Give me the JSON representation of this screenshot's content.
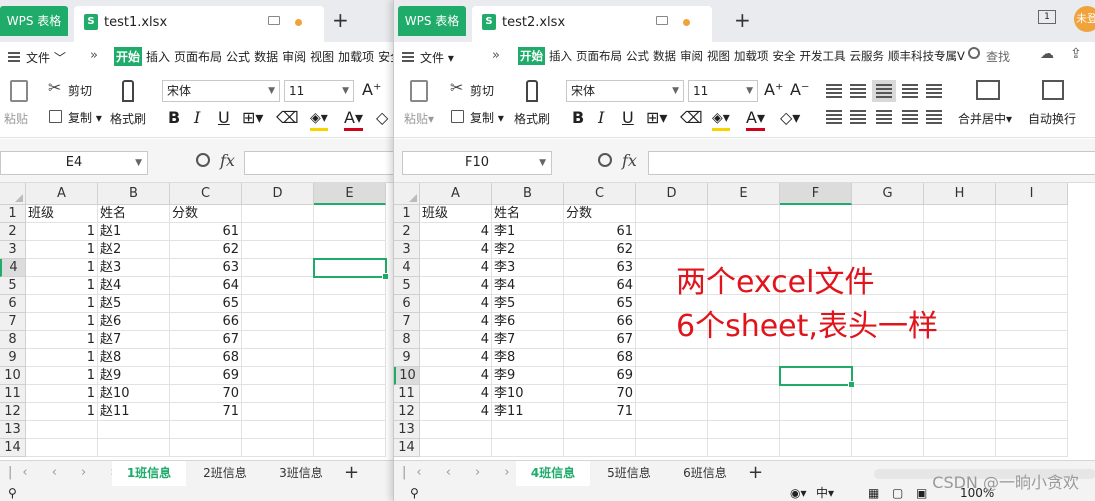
{
  "win1": {
    "app_tab": "WPS 表格",
    "doc_tab": "test1.xlsx",
    "menu_file": "文件",
    "menu_more": "»",
    "menu_tabs": [
      "开始",
      "插入",
      "页面布局",
      "公式",
      "数据",
      "审阅",
      "视图",
      "加载项",
      "安全"
    ],
    "ribbon": {
      "paste": "粘贴",
      "cut": "剪切",
      "copy": "复制",
      "format_painter": "格式刷",
      "font": "宋体",
      "size": "11"
    },
    "name_box": "E4",
    "columns": [
      "A",
      "B",
      "C",
      "D",
      "E"
    ],
    "rows": [
      "1",
      "2",
      "3",
      "4",
      "5",
      "6",
      "7",
      "8",
      "9",
      "10",
      "11",
      "12",
      "13",
      "14"
    ],
    "data": [
      [
        "班级",
        "姓名",
        "分数"
      ],
      [
        "1",
        "赵1",
        "61"
      ],
      [
        "1",
        "赵2",
        "62"
      ],
      [
        "1",
        "赵3",
        "63"
      ],
      [
        "1",
        "赵4",
        "64"
      ],
      [
        "1",
        "赵5",
        "65"
      ],
      [
        "1",
        "赵6",
        "66"
      ],
      [
        "1",
        "赵7",
        "67"
      ],
      [
        "1",
        "赵8",
        "68"
      ],
      [
        "1",
        "赵9",
        "69"
      ],
      [
        "1",
        "赵10",
        "70"
      ],
      [
        "1",
        "赵11",
        "71"
      ]
    ],
    "sheet_tabs": [
      "1班信息",
      "2班信息",
      "3班信息"
    ],
    "active_sheet": 0
  },
  "win2": {
    "app_tab": "WPS 表格",
    "doc_tab": "test2.xlsx",
    "menu_file": "文件",
    "menu_more": "»",
    "menu_tabs": [
      "开始",
      "插入",
      "页面布局",
      "公式",
      "数据",
      "审阅",
      "视图",
      "加载项",
      "安全",
      "开发工具",
      "云服务",
      "顺丰科技专属V"
    ],
    "search": "查找",
    "user_badge": "未登",
    "ribbon": {
      "paste": "粘贴",
      "cut": "剪切",
      "copy": "复制",
      "format_painter": "格式刷",
      "font": "宋体",
      "size": "11",
      "merge": "合并居中",
      "wrap": "自动换行"
    },
    "name_box": "F10",
    "columns": [
      "A",
      "B",
      "C",
      "D",
      "E",
      "F",
      "G",
      "H",
      "I"
    ],
    "rows": [
      "1",
      "2",
      "3",
      "4",
      "5",
      "6",
      "7",
      "8",
      "9",
      "10",
      "11",
      "12",
      "13",
      "14"
    ],
    "data": [
      [
        "班级",
        "姓名",
        "分数"
      ],
      [
        "4",
        "李1",
        "61"
      ],
      [
        "4",
        "李2",
        "62"
      ],
      [
        "4",
        "李3",
        "63"
      ],
      [
        "4",
        "李4",
        "64"
      ],
      [
        "4",
        "李5",
        "65"
      ],
      [
        "4",
        "李6",
        "66"
      ],
      [
        "4",
        "李7",
        "67"
      ],
      [
        "4",
        "李8",
        "68"
      ],
      [
        "4",
        "李9",
        "69"
      ],
      [
        "4",
        "李10",
        "70"
      ],
      [
        "4",
        "李11",
        "71"
      ]
    ],
    "annotation": [
      "两个excel文件",
      "6个sheet,表头一样"
    ],
    "annotation_color": "#e0151b",
    "sheet_tabs": [
      "4班信息",
      "5班信息",
      "6班信息"
    ],
    "active_sheet": 0,
    "zoom": "100%",
    "watermark": "CSDN @一晌小贪欢"
  },
  "colors": {
    "accent": "#1fab69",
    "selection": "#1fab69"
  }
}
